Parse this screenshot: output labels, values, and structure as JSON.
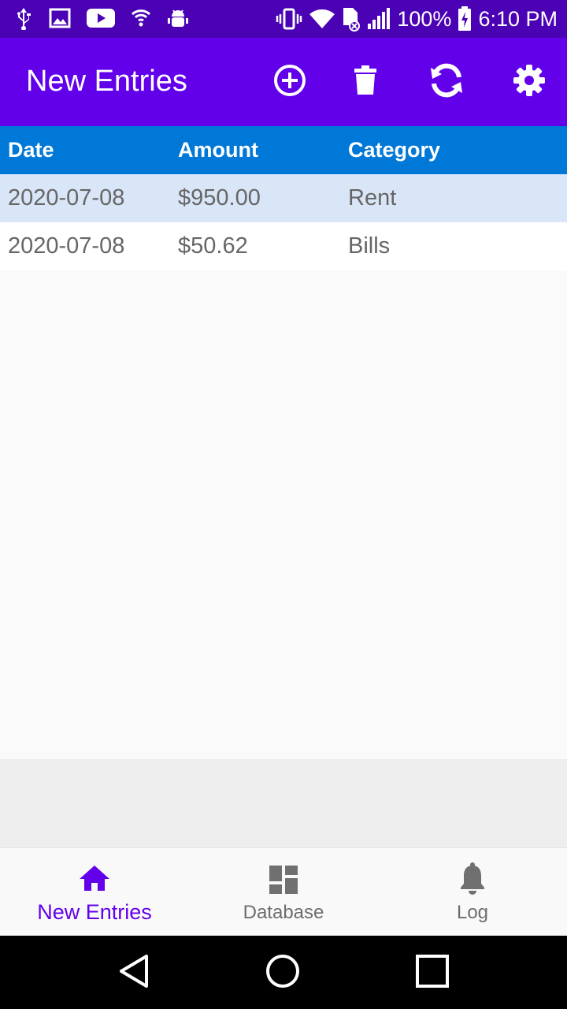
{
  "status_bar": {
    "time": "6:10 PM",
    "battery": "100%",
    "left_icons": [
      "usb-icon",
      "image-icon",
      "youtube-icon",
      "vpn-icon",
      "android-debug-icon"
    ],
    "right_icons": [
      "vibrate-icon",
      "wifi-icon",
      "no-sim-icon",
      "signal-icon",
      "battery-charging-icon"
    ]
  },
  "toolbar": {
    "title": "New Entries",
    "actions": [
      "add-icon",
      "delete-icon",
      "refresh-icon",
      "settings-icon"
    ]
  },
  "table": {
    "headers": [
      "Date",
      "Amount",
      "Category"
    ],
    "rows": [
      [
        "2020-07-08",
        "$950.00",
        "Rent"
      ],
      [
        "2020-07-08",
        "$50.62",
        "Bills"
      ]
    ]
  },
  "bottom_nav": {
    "items": [
      {
        "label": "New Entries",
        "icon": "home-icon",
        "active": true
      },
      {
        "label": "Database",
        "icon": "dashboard-icon",
        "active": false
      },
      {
        "label": "Log",
        "icon": "bell-icon",
        "active": false
      }
    ]
  },
  "colors": {
    "status_bar": "#4a02b4",
    "toolbar": "#6200ea",
    "table_header": "#0078d7",
    "selected_row": "#d9e6f7",
    "accent": "#6200ea"
  }
}
